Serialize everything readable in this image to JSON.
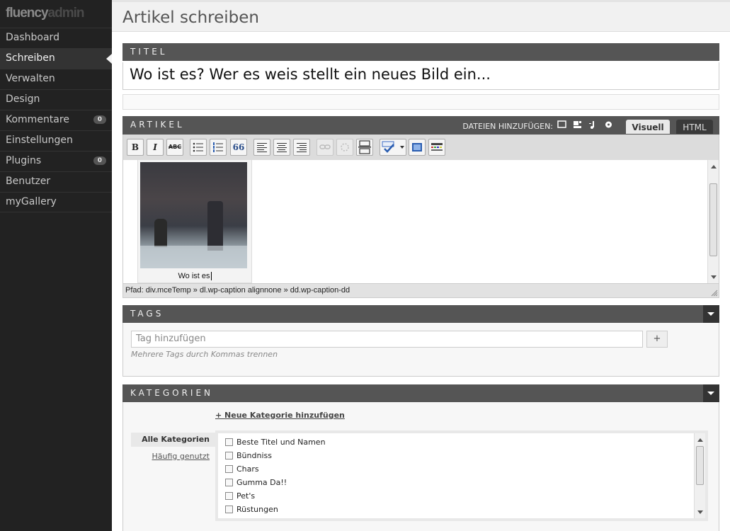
{
  "brand": {
    "part1": "fluency",
    "part2": "admin"
  },
  "sidebar": {
    "items": [
      {
        "label": "Dashboard",
        "badge": ""
      },
      {
        "label": "Schreiben",
        "badge": "",
        "active": true
      },
      {
        "label": "Verwalten",
        "badge": ""
      },
      {
        "label": "Design",
        "badge": ""
      },
      {
        "label": "Kommentare",
        "badge": "0"
      },
      {
        "label": "Einstellungen",
        "badge": ""
      },
      {
        "label": "Plugins",
        "badge": "0"
      },
      {
        "label": "Benutzer",
        "badge": ""
      },
      {
        "label": "myGallery",
        "badge": ""
      }
    ]
  },
  "page": {
    "title": "Artikel schreiben"
  },
  "titel": {
    "heading": "TITEL",
    "value": "Wo ist es? Wer es weis stellt ein neues Bild ein..."
  },
  "artikel": {
    "heading": "ARTIKEL",
    "upload_label": "DATEIEN HINZUFÜGEN:",
    "upload_icons": [
      "image-upload-icon",
      "gallery-upload-icon",
      "audio-upload-icon",
      "media-upload-icon"
    ],
    "tabs": {
      "visuell": "Visuell",
      "html": "HTML"
    },
    "caption": "Wo ist es",
    "path": "Pfad: div.mceTemp » dl.wp-caption alignnone » dd.wp-caption-dd",
    "toolbar": {
      "bold": "B",
      "italic": "I",
      "strike": "ABC",
      "quote": "66"
    }
  },
  "tags": {
    "heading": "TAGS",
    "placeholder": "Tag hinzufügen",
    "add_label": "+",
    "hint": "Mehrere Tags durch Kommas trennen"
  },
  "kategorien": {
    "heading": "KATEGORIEN",
    "add_link": "+ Neue Kategorie hinzufügen",
    "tabs": {
      "all": "Alle Kategorien",
      "popular": "Häufig genutzt"
    },
    "items": [
      "Beste Titel und Namen",
      "Bündniss",
      "Chars",
      "Gumma Da!!",
      "Pet's",
      "Rüstungen"
    ]
  }
}
